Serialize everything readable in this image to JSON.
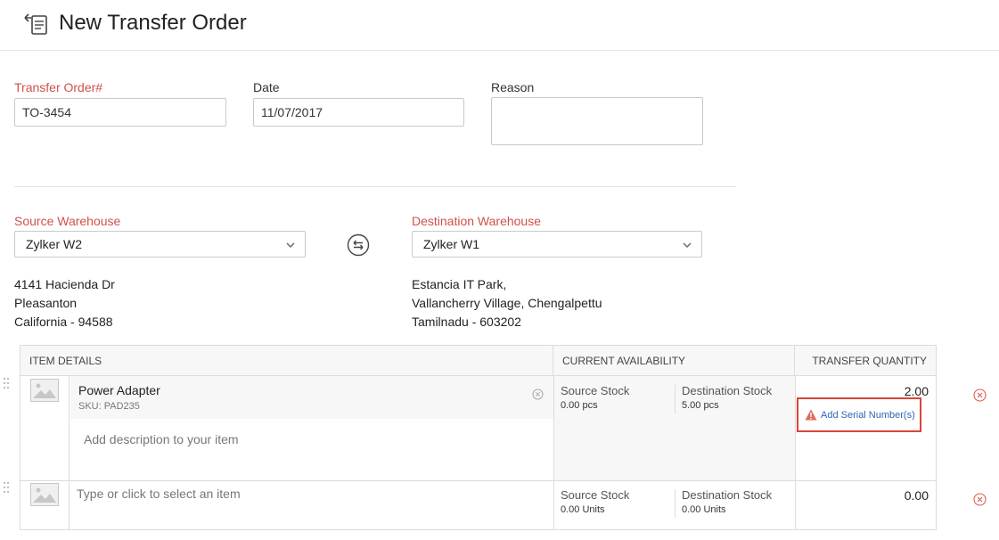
{
  "header": {
    "title": "New Transfer Order",
    "icon": "transfer-order-icon"
  },
  "form": {
    "transfer_order_label": "Transfer Order#",
    "transfer_order_value": "TO-3454",
    "date_label": "Date",
    "date_value": "11/07/2017",
    "reason_label": "Reason",
    "reason_value": ""
  },
  "warehouses": {
    "source_label": "Source Warehouse",
    "source_value": "Zylker W2",
    "source_address": [
      "4141 Hacienda Dr",
      "Pleasanton",
      "California - 94588"
    ],
    "destination_label": "Destination Warehouse",
    "destination_value": "Zylker W1",
    "destination_address": [
      "Estancia IT Park,",
      "Vallancherry Village, Chengalpettu",
      "Tamilnadu - 603202"
    ]
  },
  "table": {
    "headers": {
      "item_details": "ITEM DETAILS",
      "current_availability": "CURRENT AVAILABILITY",
      "transfer_quantity": "TRANSFER QUANTITY"
    },
    "rows": [
      {
        "item_name": "Power Adapter",
        "sku": "SKU: PAD235",
        "description_placeholder": "Add description to your item",
        "source_stock_label": "Source Stock",
        "source_stock_value": "0.00 pcs",
        "destination_stock_label": "Destination Stock",
        "destination_stock_value": "5.00 pcs",
        "quantity": "2.00",
        "serial_link": "Add Serial Number(s)"
      },
      {
        "item_placeholder": "Type or click to select an item",
        "source_stock_label": "Source Stock",
        "source_stock_value": "0.00 Units",
        "destination_stock_label": "Destination Stock",
        "destination_stock_value": "0.00 Units",
        "quantity": "0.00"
      }
    ]
  },
  "colors": {
    "required": "#d0504a",
    "link": "#2e66b6",
    "highlight": "#d9453a",
    "delete": "#e05a4f"
  }
}
